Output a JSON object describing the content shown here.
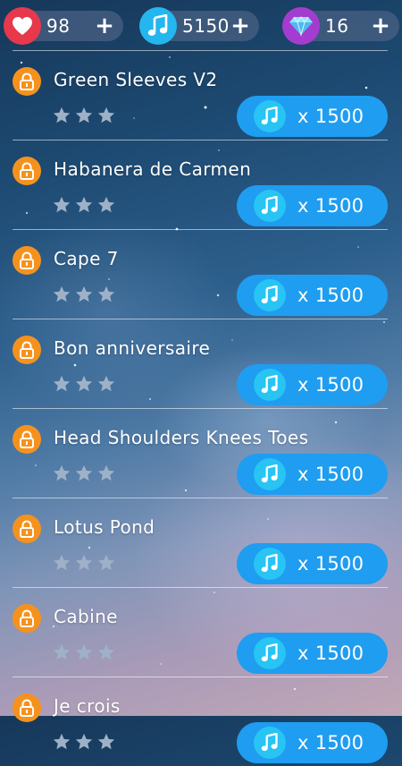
{
  "top_bar": {
    "hearts": {
      "count": "98",
      "icon": "heart-icon",
      "plus_label": "+",
      "color": "#e7394b"
    },
    "notes": {
      "count": "5150",
      "icon": "music-note-icon",
      "plus_label": "+",
      "color": "#24b6ee"
    },
    "gems": {
      "count": "16",
      "icon": "diamond-icon",
      "plus_label": "+",
      "color": "#a43cd0"
    }
  },
  "songs": [
    {
      "title": "Green Sleeves V2",
      "price": "x 1500",
      "stars": 0,
      "locked": true
    },
    {
      "title": "Habanera de Carmen",
      "price": "x 1500",
      "stars": 0,
      "locked": true
    },
    {
      "title": "Cape 7",
      "price": "x 1500",
      "stars": 0,
      "locked": true
    },
    {
      "title": "Bon anniversaire",
      "price": "x 1500",
      "stars": 0,
      "locked": true
    },
    {
      "title": "Head Shoulders Knees Toes",
      "price": "x 1500",
      "stars": 0,
      "locked": true
    },
    {
      "title": "Lotus Pond",
      "price": "x 1500",
      "stars": 0,
      "locked": true
    },
    {
      "title": "Cabine",
      "price": "x 1500",
      "stars": 0,
      "locked": true
    },
    {
      "title": "Je crois",
      "price": "x 1500",
      "stars": 0,
      "locked": true
    }
  ],
  "colors": {
    "lock_badge": "#f5921e",
    "buy_button": "#1f9df0",
    "buy_note_circle": "#27c4f4",
    "star_empty": "#9fb1c7"
  }
}
